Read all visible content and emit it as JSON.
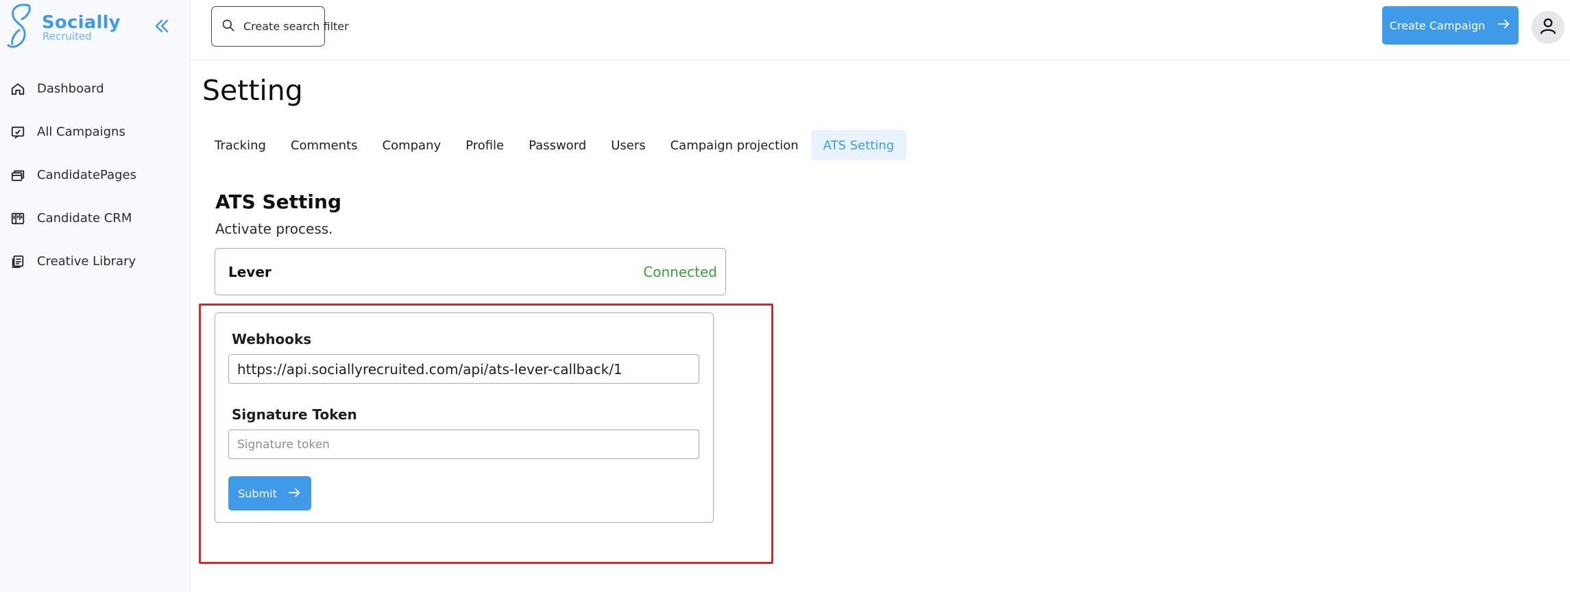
{
  "brand": {
    "name": "Socially",
    "sub": "Recruited",
    "color": "#3f9ae8"
  },
  "sidebar": {
    "collapse_icon": "chevrons-left-icon",
    "items": [
      {
        "label": "Dashboard",
        "icon": "home-icon"
      },
      {
        "label": "All Campaigns",
        "icon": "campaigns-icon"
      },
      {
        "label": "CandidatePages",
        "icon": "pages-icon"
      },
      {
        "label": "Candidate CRM",
        "icon": "crm-icon"
      },
      {
        "label": "Creative Library",
        "icon": "library-icon"
      }
    ]
  },
  "topbar": {
    "search_filter_label": "Create search filter",
    "create_campaign_label": "Create Campaign",
    "avatar_icon": "user-icon"
  },
  "page": {
    "title": "Setting",
    "tabs": [
      {
        "label": "Tracking",
        "active": false
      },
      {
        "label": "Comments",
        "active": false
      },
      {
        "label": "Company",
        "active": false
      },
      {
        "label": "Profile",
        "active": false
      },
      {
        "label": "Password",
        "active": false
      },
      {
        "label": "Users",
        "active": false
      },
      {
        "label": "Campaign projection",
        "active": false
      },
      {
        "label": "ATS Setting",
        "active": true
      }
    ]
  },
  "ats": {
    "title": "ATS Setting",
    "subtitle": "Activate process.",
    "integration": {
      "name": "Lever",
      "status": "Connected",
      "status_color": "#36a13a"
    },
    "form": {
      "webhooks_label": "Webhooks",
      "webhooks_value": "https://api.sociallyrecruited.com/api/ats-lever-callback/1",
      "token_label": "Signature Token",
      "token_placeholder": "Signature token",
      "token_value": "",
      "submit_label": "Submit"
    },
    "highlight_color": "#c9302c"
  }
}
